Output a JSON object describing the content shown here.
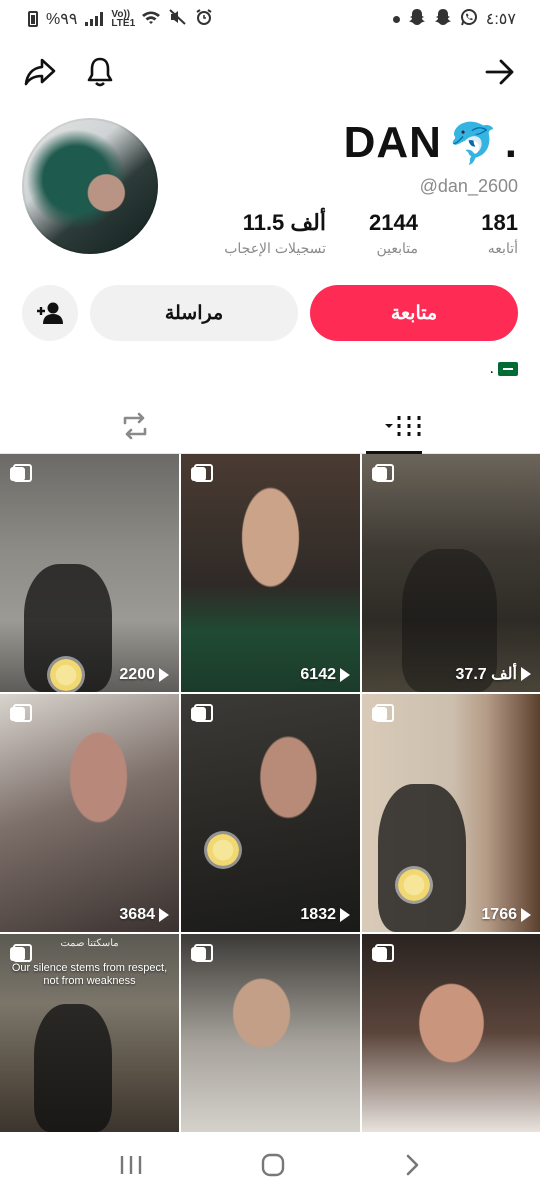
{
  "status_bar": {
    "time": "٤:٥٧",
    "battery": "%٩٩",
    "network": "Vo)) LTE1"
  },
  "profile": {
    "display_name": "DAN",
    "display_emoji": "🐬",
    "display_suffix": ".",
    "username": "@dan_2600",
    "bio_suffix": "."
  },
  "stats": [
    {
      "value": "181",
      "label": "أتابعه"
    },
    {
      "value": "2144",
      "label": "متابعين"
    },
    {
      "value": "11.5 ألف",
      "label": "تسجيلات الإعجاب"
    }
  ],
  "actions": {
    "follow_label": "متابعة",
    "message_label": "مراسلة"
  },
  "tabs": [
    {
      "name": "videos",
      "icon": "grid-icon",
      "active": true
    },
    {
      "name": "reposts",
      "icon": "repost-icon",
      "active": false
    }
  ],
  "posts": [
    {
      "views": "2200"
    },
    {
      "views": "6142"
    },
    {
      "views": "37.7 ألف"
    },
    {
      "views": "3684"
    },
    {
      "views": "1832"
    },
    {
      "views": "1766"
    },
    {
      "views": "",
      "caption_ar": "ماسكتنا صمت",
      "caption": "Our silence stems from respect, not from weakness"
    },
    {
      "views": ""
    },
    {
      "views": ""
    }
  ],
  "colors": {
    "accent": "#fe2c55",
    "secondary_button": "#f1f1f2",
    "muted_text": "#8a8a8a"
  }
}
